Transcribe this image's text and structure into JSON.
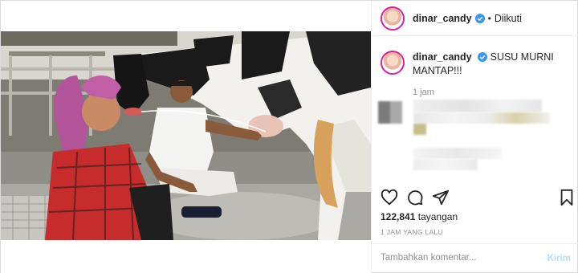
{
  "header": {
    "username": "dinar_candy",
    "separator": "•",
    "follow_status": "Diikuti"
  },
  "caption": {
    "username": "dinar_candy",
    "text": "SUSU MURNI MANTAP!!!",
    "time": "1 jam"
  },
  "stats": {
    "views_count": "122,841",
    "views_label": "tayangan",
    "time_ago": "1 JAM YANG LALU"
  },
  "comment": {
    "placeholder": "Tambahkan komentar...",
    "send_label": "Kirim"
  },
  "icons": {
    "like": "heart-icon",
    "comment": "comment-icon",
    "share": "paper-plane-icon",
    "save": "bookmark-icon",
    "verified": "verified-badge-icon"
  },
  "colors": {
    "verified_blue": "#3897f0",
    "send_disabled": "#b2dffc",
    "muted_text": "#8e8e8e",
    "border": "#dbdbdb"
  }
}
